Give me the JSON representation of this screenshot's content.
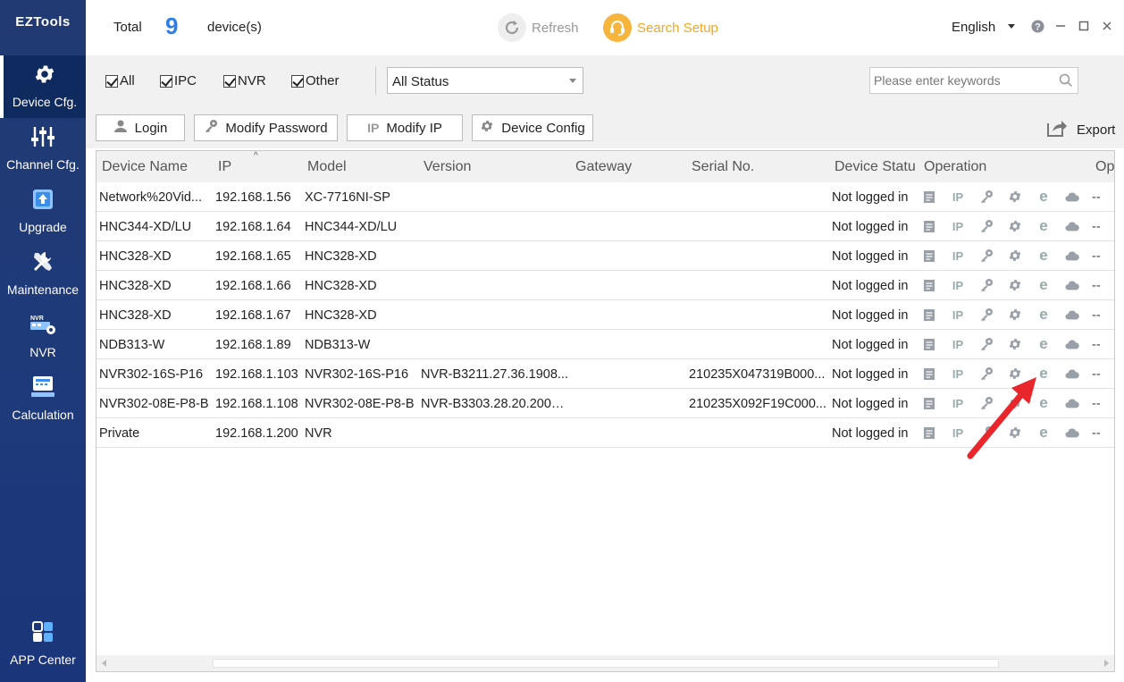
{
  "app": {
    "logo": "EZTools"
  },
  "sidebar": {
    "items": [
      {
        "label": "Device Cfg.",
        "icon": "gear-icon",
        "active": true
      },
      {
        "label": "Channel Cfg.",
        "icon": "sliders-icon"
      },
      {
        "label": "Upgrade",
        "icon": "upgrade-icon"
      },
      {
        "label": "Maintenance",
        "icon": "tools-icon"
      },
      {
        "label": "NVR",
        "icon": "nvr-icon",
        "badge": "NVR"
      },
      {
        "label": "Calculation",
        "icon": "calculator-icon"
      }
    ],
    "app_center": {
      "label": "APP Center",
      "icon": "app-grid-icon"
    }
  },
  "topbar": {
    "total_label": "Total",
    "total_count": "9",
    "total_unit": "device(s)",
    "refresh_label": "Refresh",
    "search_setup_label": "Search Setup",
    "language": "English",
    "accent_color": "#2d7ee8",
    "search_color": "#f4a623"
  },
  "filters": {
    "checkboxes": [
      {
        "label": "All",
        "checked": true
      },
      {
        "label": "IPC",
        "checked": true
      },
      {
        "label": "NVR",
        "checked": true
      },
      {
        "label": "Other",
        "checked": true
      }
    ],
    "status_select": "All Status",
    "search_placeholder": "Please enter keywords"
  },
  "actions": {
    "login": "Login",
    "modify_password": "Modify Password",
    "modify_ip": "Modify IP",
    "device_config": "Device Config",
    "export": "Export"
  },
  "table": {
    "columns": [
      "Device Name",
      "IP",
      "Model",
      "Version",
      "Gateway",
      "Serial No.",
      "Device Statu",
      "Operation",
      "Op"
    ],
    "operation_icons": [
      "doc-icon",
      "ip-icon",
      "key-icon",
      "gear-icon",
      "browser-e-icon",
      "cloud-icon"
    ],
    "rows": [
      {
        "name": "Network%20Vid...",
        "ip": "192.168.1.56",
        "model": "XC-7716NI-SP",
        "version": "",
        "gateway": "",
        "serial": "",
        "status": "Not logged in",
        "op2": "--"
      },
      {
        "name": "HNC344-XD/LU",
        "ip": "192.168.1.64",
        "model": "HNC344-XD/LU",
        "version": "",
        "gateway": "",
        "serial": "",
        "status": "Not logged in",
        "op2": "--"
      },
      {
        "name": "HNC328-XD",
        "ip": "192.168.1.65",
        "model": "HNC328-XD",
        "version": "",
        "gateway": "",
        "serial": "",
        "status": "Not logged in",
        "op2": "--"
      },
      {
        "name": "HNC328-XD",
        "ip": "192.168.1.66",
        "model": "HNC328-XD",
        "version": "",
        "gateway": "",
        "serial": "",
        "status": "Not logged in",
        "op2": "--"
      },
      {
        "name": "HNC328-XD",
        "ip": "192.168.1.67",
        "model": "HNC328-XD",
        "version": "",
        "gateway": "",
        "serial": "",
        "status": "Not logged in",
        "op2": "--"
      },
      {
        "name": "NDB313-W",
        "ip": "192.168.1.89",
        "model": "NDB313-W",
        "version": "",
        "gateway": "",
        "serial": "",
        "status": "Not logged in",
        "op2": "--"
      },
      {
        "name": "NVR302-16S-P16",
        "ip": "192.168.1.103",
        "model": "NVR302-16S-P16",
        "version": "NVR-B3211.27.36.1908...",
        "gateway": "",
        "serial": "210235X047319B000...",
        "status": "Not logged in",
        "op2": "--"
      },
      {
        "name": "NVR302-08E-P8-B",
        "ip": "192.168.1.108",
        "model": "NVR302-08E-P8-B",
        "version": "NVR-B3303.28.20.2001...",
        "gateway": "",
        "serial": "210235X092F19C000...",
        "status": "Not logged in",
        "op2": "--"
      },
      {
        "name": "Private",
        "ip": "192.168.1.200",
        "model": "NVR",
        "version": "",
        "gateway": "",
        "serial": "",
        "status": "Not logged in",
        "op2": "--"
      }
    ]
  },
  "annotation": {
    "arrow_color": "#e8262b",
    "points_to": "browser-e-icon"
  }
}
